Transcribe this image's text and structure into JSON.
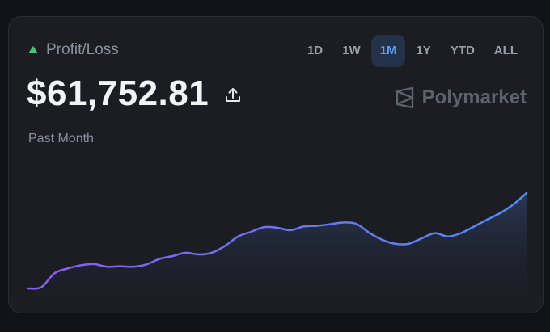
{
  "header": {
    "indicator_icon": "triangle-up-icon",
    "label": "Profit/Loss"
  },
  "ranges": [
    "1D",
    "1W",
    "1M",
    "1Y",
    "YTD",
    "ALL"
  ],
  "active_range": "1M",
  "value": "$61,752.81",
  "share_icon": "upload-icon",
  "brand": {
    "name": "Polymarket",
    "logo_icon": "polymarket-logo-icon"
  },
  "period_label": "Past Month",
  "colors": {
    "positive": "#4ec27a",
    "accent": "#5a9bf0",
    "line_start": "#8a5cf0",
    "line_end": "#4f8cf2"
  },
  "chart_data": {
    "type": "area",
    "title": "",
    "xlabel": "",
    "ylabel": "",
    "x_axis_visible": false,
    "y_axis_visible": false,
    "grid": false,
    "series": [
      {
        "values": [
          0.0,
          0.8,
          9.5,
          12.5,
          14.5,
          15.3,
          13.6,
          13.9,
          13.6,
          15.0,
          18.5,
          20.3,
          22.4,
          21.3,
          22.4,
          26.7,
          32.6,
          35.6,
          38.5,
          38.1,
          36.6,
          38.9,
          39.3,
          40.3,
          41.4,
          40.6,
          35.0,
          30.5,
          28.0,
          28.0,
          31.4,
          34.7,
          32.6,
          34.7,
          38.9,
          43.2,
          47.4,
          52.8,
          59.9
        ]
      }
    ]
  }
}
